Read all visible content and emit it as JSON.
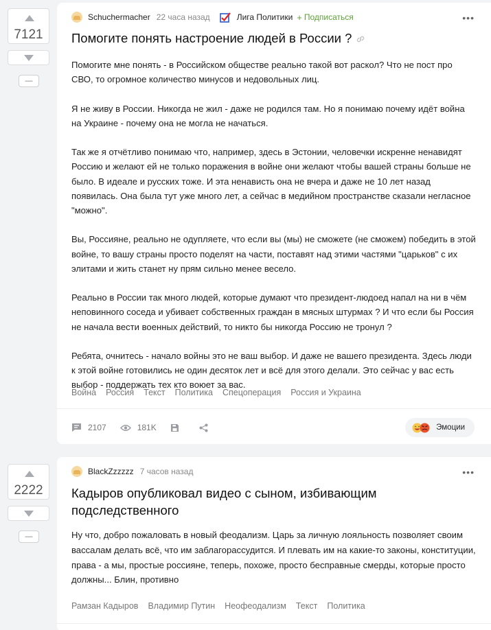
{
  "posts": [
    {
      "rating": "7121",
      "minus_label": "—",
      "author": "Schuchermacher",
      "time": "22 часа назад",
      "community": "Лига Политики",
      "subscribe": "Подписаться",
      "title": "Помогите понять настроение людей в России ?",
      "paragraphs": [
        "Помогите мне понять - в Российском обществе реально такой вот раскол? Что не пост про СВО, то огромное количество минусов и недовольных лиц.",
        "Я не живу в России. Никогда не жил - даже не родился там. Но я понимаю почему идёт война на Украине - почему она не могла не начаться.",
        "Так же я отчётливо понимаю что, например, здесь в Эстонии, человечки искренне ненавидят Россию и желают ей не только поражения в войне они желают чтобы вашей страны больше не было. В идеале и русских тоже. И эта ненависть она не вчера и даже не 10 лет назад появилась. Она была тут уже много лет, а сейчас в медийном пространстве сказали негласное \"можно\".",
        "Вы, Россияне, реально не одупляете, что если вы (мы) не сможете (не сможем) победить в этой войне, то вашу страны просто поделят на части, поставят над этими частями \"царьков\" с их элитами и жить станет ну прям сильно менее весело.",
        "Реально в России так много людей, которые думают что президент-людоед напал на ни в чём неповинного соседа и убивает собственных граждан в мясных штурмах ? И что если бы Россия не начала вести военных действий, то никто бы никогда Россию не тронул ?",
        "Ребята, очнитесь - начало войны это не ваш выбор. И даже не вашего президента. Здесь люди к этой войне готовились не один десяток лет и всё для этого делали. Это сейчас у вас есть выбор - поддержать тех кто воюет за вас."
      ],
      "tags": [
        "Война",
        "Россия",
        "Текст",
        "Политика",
        "Спецоперация",
        "Россия и Украина"
      ],
      "comments": "2107",
      "views": "181K",
      "emotions_label": "Эмоции"
    },
    {
      "rating": "2222",
      "minus_label": "—",
      "author": "BlackZzzzzz",
      "time": "7 часов назад",
      "title": "Кадыров опубликовал видео с сыном, избивающим подследственного",
      "paragraphs": [
        "Ну что, добро пожаловать в новый феодализм. Царь за личную лояльность позволяет своим вассалам делать всё, что им заблагорассудится. И плевать им на какие-то законы, конституции, права - а мы, простые россияне, теперь, похоже, просто бесправные смерды, которые просто должны... Блин, противно"
      ],
      "tags": [
        "Рамзан Кадыров",
        "Владимир Путин",
        "Неофеодализм",
        "Текст",
        "Политика"
      ]
    }
  ],
  "colors": {
    "accent_green": "#5fa03a",
    "background": "#f2f3f4",
    "card": "#ffffff"
  }
}
